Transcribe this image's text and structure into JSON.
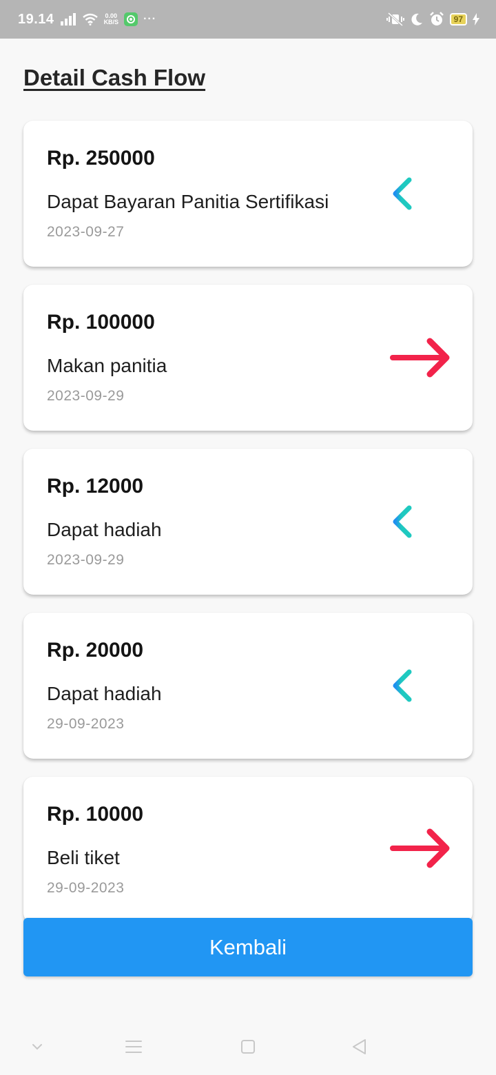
{
  "status_bar": {
    "time": "19.14",
    "net_speed_value": "0.00",
    "net_speed_unit": "KB/S",
    "more": "···",
    "battery": "97"
  },
  "page": {
    "title": "Detail Cash Flow"
  },
  "transactions": [
    {
      "amount": "Rp. 250000",
      "description": "Dapat Bayaran Panitia Sertifikasi",
      "date": "2023-09-27",
      "direction": "in",
      "icon": "arrow-left-icon"
    },
    {
      "amount": "Rp. 100000",
      "description": "Makan panitia",
      "date": "2023-09-29",
      "direction": "out",
      "icon": "arrow-right-icon"
    },
    {
      "amount": "Rp. 12000",
      "description": "Dapat hadiah",
      "date": "2023-09-29",
      "direction": "in",
      "icon": "arrow-left-icon"
    },
    {
      "amount": "Rp. 20000",
      "description": "Dapat hadiah",
      "date": "29-09-2023",
      "direction": "in",
      "icon": "arrow-left-icon"
    },
    {
      "amount": "Rp. 10000",
      "description": "Beli tiket",
      "date": "29-09-2023",
      "direction": "out",
      "icon": "arrow-right-icon"
    }
  ],
  "actions": {
    "back_label": "Kembali"
  },
  "colors": {
    "income_arrow": "#1fc9c0",
    "income_arrow_tip": "#1f8ff0",
    "expense_arrow": "#f2234a",
    "button": "#2196f3"
  },
  "nav_bar": {
    "icons": [
      "chevron-down-icon",
      "menu-icon",
      "home-square-icon",
      "back-triangle-icon"
    ]
  }
}
